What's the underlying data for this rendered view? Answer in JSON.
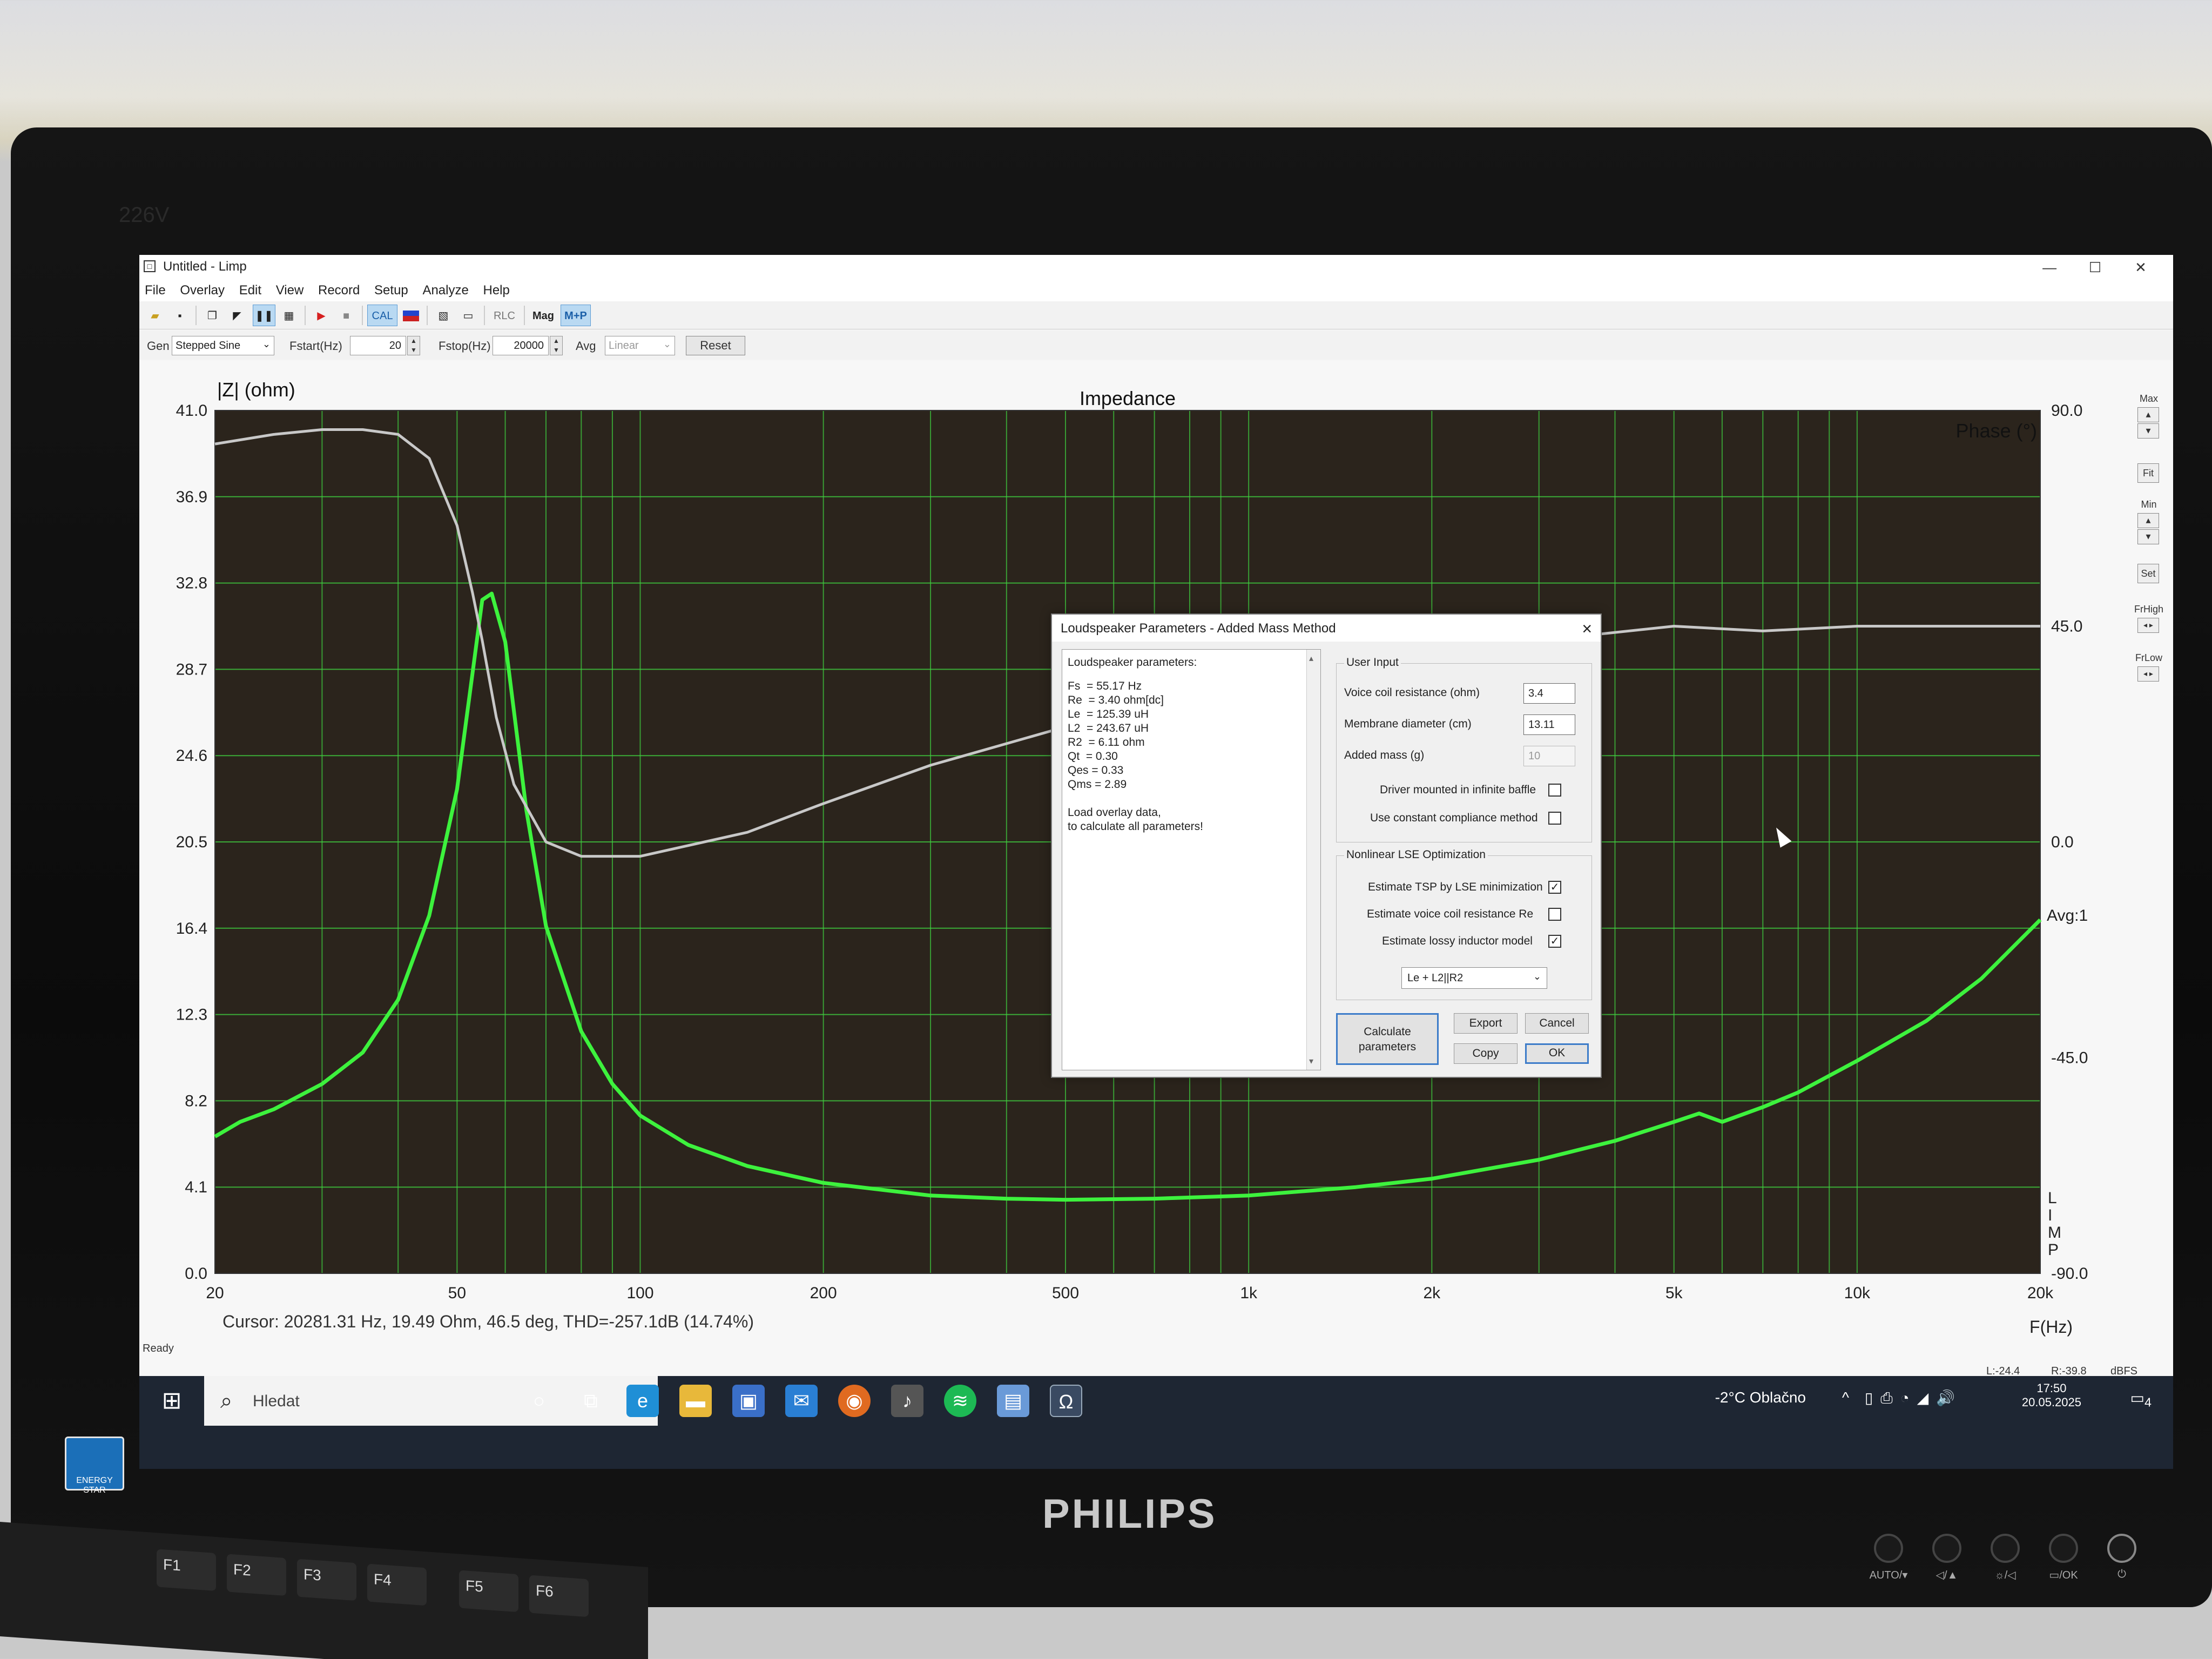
{
  "monitor": {
    "brand": "PHILIPS",
    "model": "226V",
    "energy_star": "ENERGY STAR",
    "buttons": [
      "AUTO/▾",
      "◁/▲",
      "☼/◁",
      "▭/OK",
      "⏻"
    ]
  },
  "keyboard": {
    "keys": [
      "F1",
      "F2",
      "F3",
      "F4",
      "F5",
      "F6"
    ]
  },
  "window": {
    "title": "Untitled - Limp",
    "min": "—",
    "max": "☐",
    "close": "✕"
  },
  "menu": [
    "File",
    "Overlay",
    "Edit",
    "View",
    "Record",
    "Setup",
    "Analyze",
    "Help"
  ],
  "toolbar": {
    "cal": "CAL",
    "rlc": "RLC",
    "mag": "Mag",
    "mp": "M+P"
  },
  "genbar": {
    "gen_label": "Gen",
    "gen_value": "Stepped Sine",
    "fstart_label": "Fstart(Hz)",
    "fstart_value": "20",
    "fstop_label": "Fstop(Hz)",
    "fstop_value": "20000",
    "avg_label": "Avg",
    "avg_value": "Linear",
    "reset_label": "Reset"
  },
  "side_panel": {
    "max": "Max",
    "fit": "Fit",
    "min": "Min",
    "set": "Set",
    "frhigh": "FrHigh",
    "frlow": "FrLow"
  },
  "chart_data": {
    "type": "line",
    "title": "Impedance",
    "ylabel": "|Z| (ohm)",
    "y2label": "Phase (°)",
    "xlabel": "F(Hz)",
    "xscale": "log",
    "xlim": [
      20,
      20000
    ],
    "ylim": [
      0,
      41.0
    ],
    "y2lim": [
      -90,
      90
    ],
    "grid": true,
    "yticks": [
      "41.0",
      "36.9",
      "32.8",
      "28.7",
      "24.6",
      "20.5",
      "16.4",
      "12.3",
      "8.2",
      "4.1",
      "0.0"
    ],
    "y2ticks": [
      "90.0",
      "45.0",
      "0.0",
      "-45.0",
      "-90.0"
    ],
    "xticks": [
      {
        "v": 20,
        "label": "20"
      },
      {
        "v": 50,
        "label": "50"
      },
      {
        "v": 100,
        "label": "100"
      },
      {
        "v": 200,
        "label": "200"
      },
      {
        "v": 500,
        "label": "500"
      },
      {
        "v": 1000,
        "label": "1k"
      },
      {
        "v": 2000,
        "label": "2k"
      },
      {
        "v": 5000,
        "label": "5k"
      },
      {
        "v": 10000,
        "label": "10k"
      },
      {
        "v": 20000,
        "label": "20k"
      }
    ],
    "avg_label": "Avg:1",
    "side_label": "LIMP",
    "series": [
      {
        "color": "#3df23d",
        "axis": "left",
        "x": [
          20,
          22,
          25,
          30,
          35,
          40,
          45,
          50,
          53,
          55,
          57,
          60,
          65,
          70,
          80,
          90,
          100,
          120,
          150,
          200,
          300,
          400,
          500,
          700,
          1000,
          1500,
          2000,
          3000,
          4000,
          5000,
          5500,
          6000,
          7000,
          8000,
          10000,
          13000,
          16000,
          20000
        ],
        "y": [
          6.5,
          7.2,
          7.8,
          9.0,
          10.5,
          13.0,
          17.0,
          23.0,
          28.5,
          32.0,
          32.3,
          30.0,
          22.0,
          16.5,
          11.5,
          9.0,
          7.5,
          6.1,
          5.1,
          4.3,
          3.7,
          3.55,
          3.5,
          3.55,
          3.7,
          4.1,
          4.5,
          5.4,
          6.3,
          7.2,
          7.6,
          7.2,
          7.9,
          8.6,
          10.1,
          12.0,
          14.0,
          16.8
        ]
      },
      {
        "color": "#c8c8c8",
        "axis": "right",
        "x": [
          20,
          25,
          30,
          35,
          40,
          45,
          50,
          53,
          55,
          58,
          62,
          70,
          80,
          100,
          150,
          200,
          300,
          500,
          700,
          1000,
          2000,
          3000,
          5000,
          7000,
          10000,
          20000
        ],
        "y": [
          83,
          85,
          86,
          86,
          85,
          80,
          66,
          52,
          42,
          26,
          12,
          0,
          -3,
          -3,
          2,
          8,
          16,
          24,
          29,
          34,
          40,
          42,
          45,
          44,
          45,
          45
        ]
      }
    ]
  },
  "status": {
    "ready": "Ready",
    "cursor": "Cursor: 20281.31 Hz, 19.49 Ohm, 46.5 deg, THD=-257.1dB (14.74%)",
    "level_l": "L:-24.4",
    "level_r": "R:-39.8",
    "level_unit": "dBFS"
  },
  "dialog": {
    "title": "Loudspeaker Parameters - Added Mass Method",
    "results_header": "Loudspeaker parameters:",
    "results": [
      "Fs  = 55.17 Hz",
      "Re  = 3.40 ohm[dc]",
      "Le  = 125.39 uH",
      "L2  = 243.67 uH",
      "R2  = 6.11 ohm",
      "Qt  = 0.30",
      "Qes = 0.33",
      "Qms = 2.89"
    ],
    "note_1": "Load overlay data,",
    "note_2": "to calculate all parameters!",
    "user_input_title": "User Input",
    "voice_coil_label": "Voice coil resistance (ohm)",
    "voice_coil_value": "3.4",
    "membrane_label": "Membrane diameter (cm)",
    "membrane_value": "13.11",
    "added_mass_label": "Added mass (g)",
    "added_mass_value": "10",
    "infinite_baffle_label": "Driver mounted in infinite baffle",
    "infinite_baffle_checked": false,
    "constant_compliance_label": "Use constant compliance method",
    "constant_compliance_checked": false,
    "nonlinear_title": "Nonlinear LSE Optimization",
    "estimate_tsp_label": "Estimate TSP by LSE minimization",
    "estimate_tsp_checked": true,
    "estimate_re_label": "Estimate voice coil resistance Re",
    "estimate_re_checked": false,
    "estimate_lossy_label": "Estimate lossy inductor model",
    "estimate_lossy_checked": true,
    "model_value": "Le + L2||R2",
    "calculate_line1": "Calculate",
    "calculate_line2": "parameters",
    "export": "Export",
    "cancel": "Cancel",
    "copy": "Copy",
    "ok": "OK"
  },
  "taskbar": {
    "search_placeholder": "Hledat",
    "weather": "-2°C  Oblačno",
    "time": "17:50",
    "date": "20.05.2025",
    "notifications": "4",
    "tray_chevron": "^"
  }
}
